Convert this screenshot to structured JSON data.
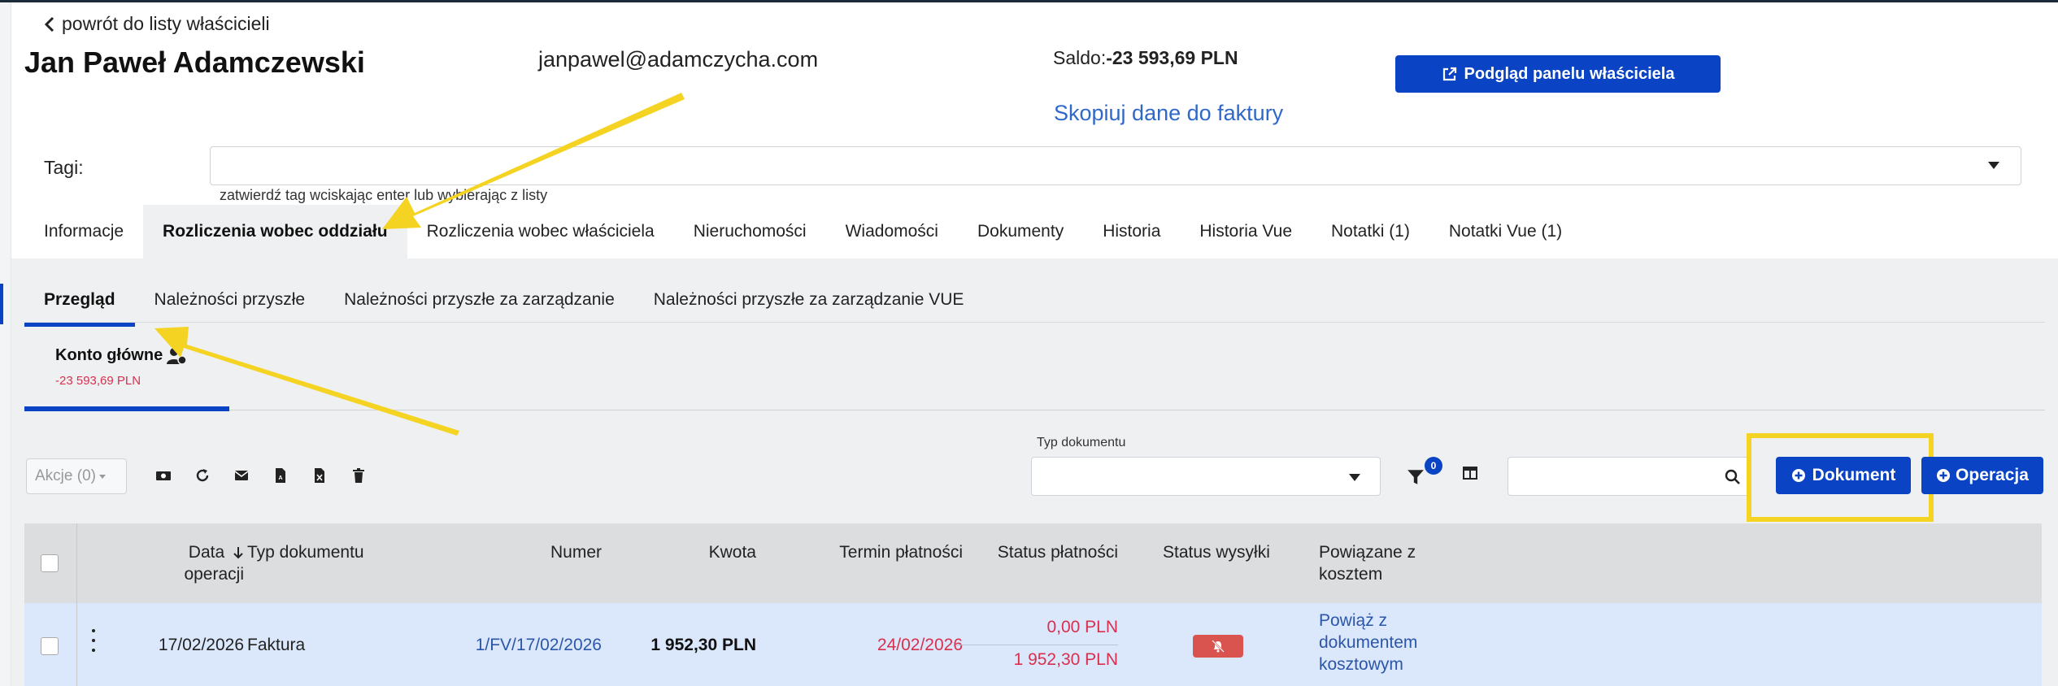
{
  "header": {
    "back_label": "powrót do listy właścicieli",
    "owner_name": "Jan Paweł Adamczewski",
    "email": "janpawel@adamczycha.com",
    "saldo_label": "Saldo:",
    "saldo_value": "-23 593,69 PLN",
    "copy_invoice_label": "Skopiuj dane do faktury",
    "preview_button_label": "Podgląd panelu właściciela"
  },
  "tags": {
    "label": "Tagi:",
    "hint": "zatwierdź tag wciskając enter lub wybierając z listy"
  },
  "main_tabs": [
    {
      "label": "Informacje"
    },
    {
      "label": "Rozliczenia wobec oddziału"
    },
    {
      "label": "Rozliczenia wobec właściciela"
    },
    {
      "label": "Nieruchomości"
    },
    {
      "label": "Wiadomości"
    },
    {
      "label": "Dokumenty"
    },
    {
      "label": "Historia"
    },
    {
      "label": "Historia Vue"
    },
    {
      "label": "Notatki (1)"
    },
    {
      "label": "Notatki Vue (1)"
    }
  ],
  "sub_tabs": [
    {
      "label": "Przegląd"
    },
    {
      "label": "Należności przyszłe"
    },
    {
      "label": "Należności przyszłe za zarządzanie"
    },
    {
      "label": "Należności przyszłe za zarządzanie VUE"
    }
  ],
  "account": {
    "name": "Konto główne",
    "balance": "-23 593,69 PLN"
  },
  "toolbar": {
    "actions_label": "Akcje (0)",
    "doc_type_label": "Typ dokumentu",
    "filter_count": "0",
    "add_document_label": "Dokument",
    "add_operation_label": "Operacja"
  },
  "table": {
    "headers": {
      "date_line1": "Data",
      "date_line2": "operacji",
      "doc_type": "Typ dokumentu",
      "number": "Numer",
      "amount": "Kwota",
      "due_date": "Termin płatności",
      "payment_status": "Status płatności",
      "shipping_status": "Status wysyłki",
      "linked_line1": "Powiązane z",
      "linked_line2": "kosztem"
    },
    "rows": [
      {
        "date": "17/02/2026",
        "doc_type": "Faktura",
        "number": "1/FV/17/02/2026",
        "amount": "1 952,30 PLN",
        "due_date": "24/02/2026",
        "paid": "0,00 PLN",
        "remaining": "1 952,30 PLN",
        "link_line1": "Powiąż z",
        "link_line2": "dokumentem",
        "link_line3": "kosztowym"
      }
    ]
  },
  "colors": {
    "primary": "#0a44c4",
    "negative": "#d9304f",
    "highlight": "#f5d323",
    "link": "#3068c8"
  }
}
